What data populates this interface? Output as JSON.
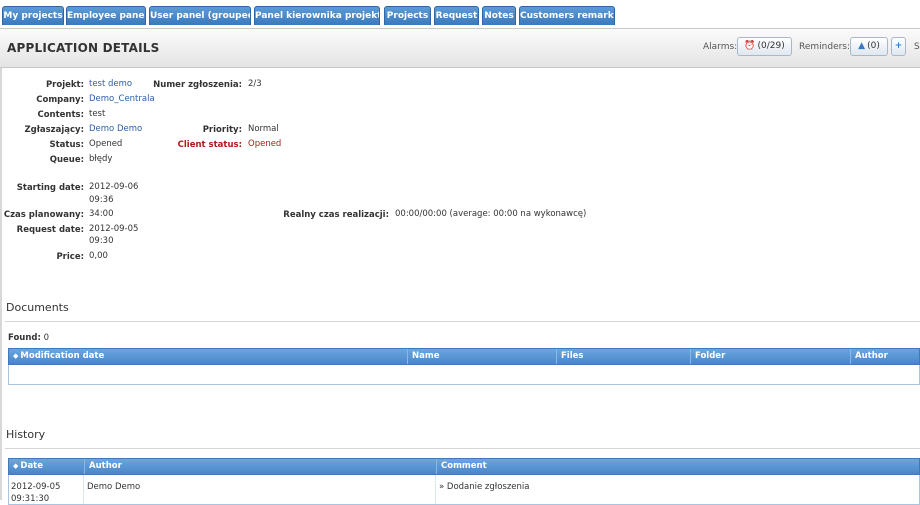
{
  "tabs": [
    {
      "label": "My projects"
    },
    {
      "label": "Employee panel"
    },
    {
      "label": "User panel (grouped)"
    },
    {
      "label": "Panel kierownika projektu"
    },
    {
      "label": "Projects"
    },
    {
      "label": "Request"
    },
    {
      "label": "Notes"
    },
    {
      "label": "Customers remarks"
    }
  ],
  "header": {
    "title": "APPLICATION DETAILS",
    "alarms_label": "Alarms:",
    "alarms_count": "(0/29)",
    "reminders_label": "Reminders:",
    "reminders_count": "(0)",
    "add_symbol": "+",
    "cut_letter": "S"
  },
  "details": {
    "projekt_label": "Projekt:",
    "projekt_value": "test demo",
    "numer_label": "Numer zgłoszenia:",
    "numer_value": "2/3",
    "company_label": "Company:",
    "company_value": "Demo_Centrala",
    "contents_label": "Contents:",
    "contents_value": "test",
    "zglaszajacy_label": "Zgłaszający:",
    "zglaszajacy_value": "Demo Demo",
    "priority_label": "Priority:",
    "priority_value": "Normal",
    "status_label": "Status:",
    "status_value": "Opened",
    "client_status_label": "Client status:",
    "client_status_value": "Opened",
    "queue_label": "Queue:",
    "queue_value": "błędy",
    "starting_label": "Starting date:",
    "starting_date": "2012-09-06",
    "starting_time": "09:36",
    "czas_label": "Czas planowany:",
    "czas_value": "34:00",
    "realny_label": "Realny czas realizacji:",
    "realny_value": "00:00/00:00 (average: 00:00 na wykonawcę)",
    "request_label": "Request date:",
    "request_date": "2012-09-05",
    "request_time": "09:30",
    "price_label": "Price:",
    "price_value": "0,00"
  },
  "documents": {
    "title": "Documents",
    "found_label": "Found:",
    "found_count": "0",
    "columns": [
      "Modification date",
      "Name",
      "Files",
      "Folder",
      "Author"
    ]
  },
  "history": {
    "title": "History",
    "columns": [
      "Date",
      "Author",
      "Comment"
    ],
    "rows": [
      {
        "date": "2012-09-05",
        "time": "09:31:30",
        "author": "Demo Demo",
        "comment": "» Dodanie zgłoszenia"
      }
    ]
  },
  "colors": {
    "tab": "#3a79be",
    "link": "#2a5fa8",
    "client_status": "#b01818",
    "grid_header": "#4a86c6"
  }
}
